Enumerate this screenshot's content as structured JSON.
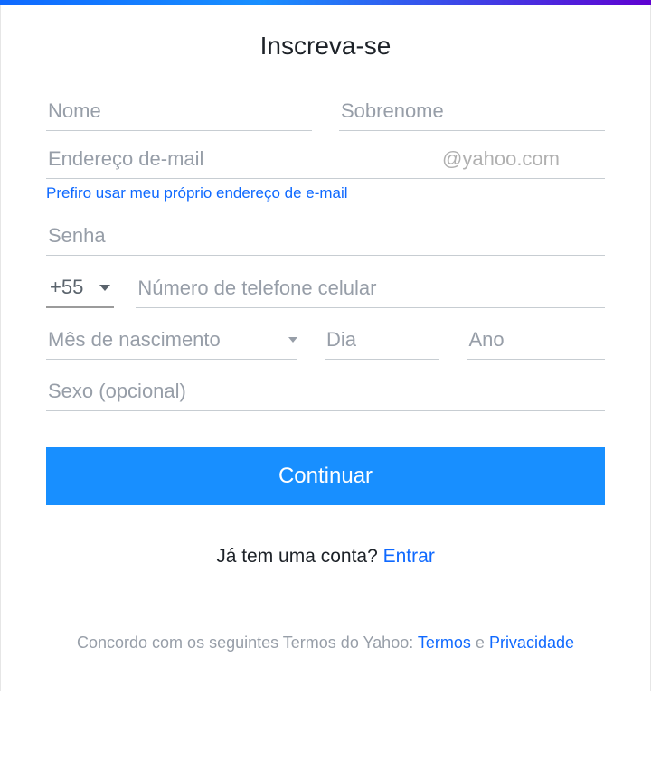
{
  "title": "Inscreva-se",
  "fields": {
    "first_name_placeholder": "Nome",
    "last_name_placeholder": "Sobrenome",
    "email_placeholder": "Endereço de-mail",
    "email_suffix": "@yahoo.com",
    "own_email_link": "Prefiro usar meu próprio endereço de e-mail",
    "password_placeholder": "Senha",
    "country_code": "+55",
    "phone_placeholder": "Número de telefone celular",
    "birth_month_placeholder": "Mês de nascimento",
    "birth_day_placeholder": "Dia",
    "birth_year_placeholder": "Ano",
    "gender_placeholder": "Sexo (opcional)"
  },
  "buttons": {
    "continue": "Continuar"
  },
  "signin": {
    "prompt": "Já tem uma conta? ",
    "link": "Entrar"
  },
  "terms": {
    "prefix": "Concordo com os seguintes Termos do Yahoo: ",
    "terms_link": "Termos",
    "and": " e ",
    "privacy_link": "Privacidade"
  }
}
